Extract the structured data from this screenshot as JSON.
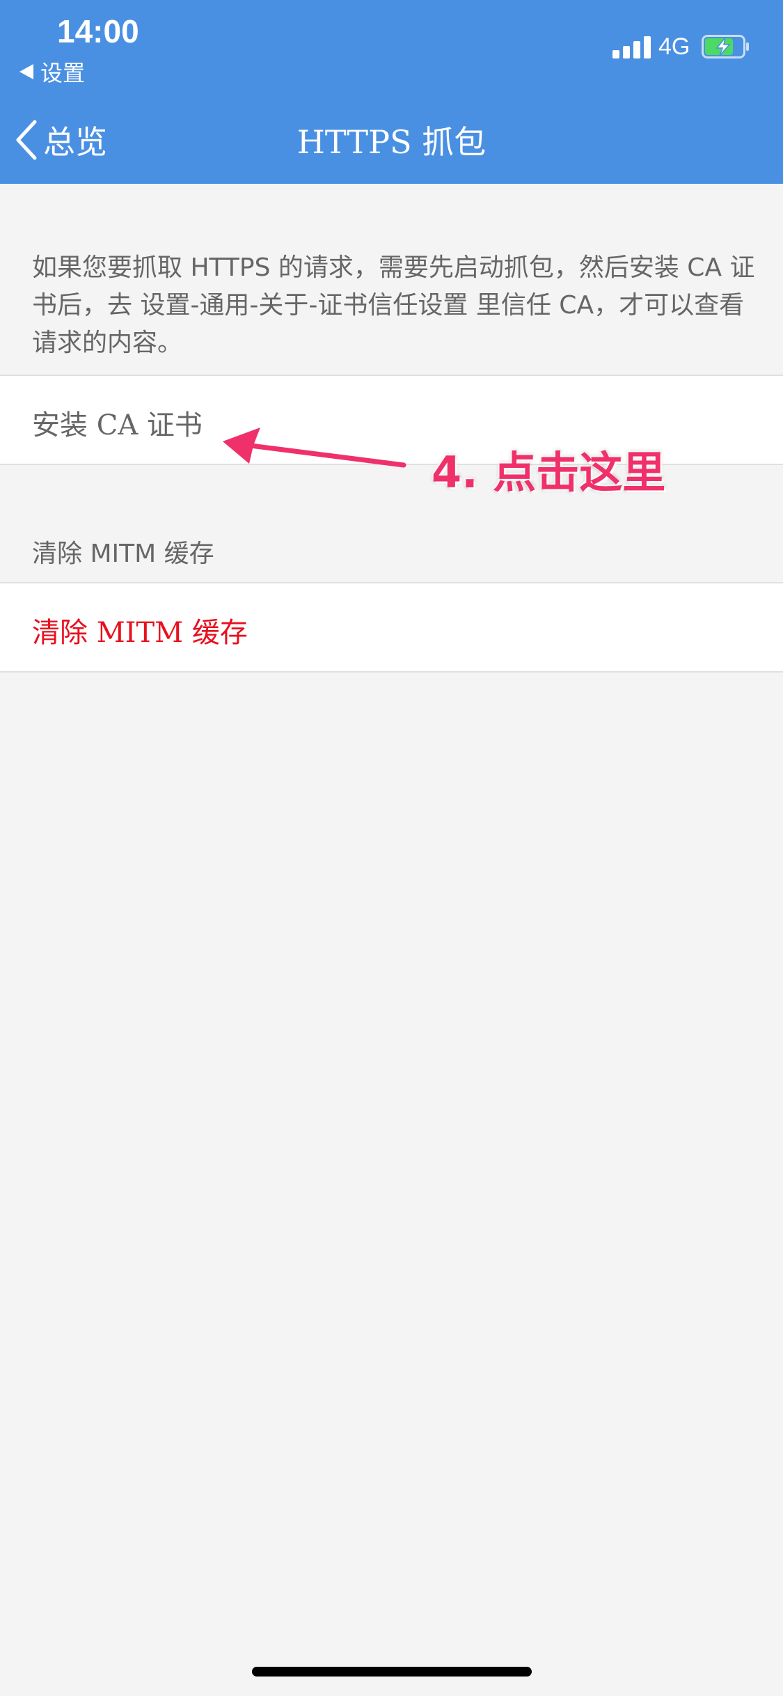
{
  "status_bar": {
    "time": "14:00",
    "back_app": "设置",
    "network": "4G",
    "signal_icon": "signal-bars-icon",
    "battery_icon": "battery-charging-icon",
    "colors": {
      "bar": "#4a90e2",
      "battery_fill": "#4cd964"
    }
  },
  "nav": {
    "back_label": "总览",
    "title": "HTTPS 抓包"
  },
  "info_text": "如果您要抓取 HTTPS 的请求，需要先启动抓包，然后安装 CA 证书后，去 设置-通用-关于-证书信任设置 里信任 CA，才可以查看请求的内容。",
  "install_row": {
    "label": "安装 CA 证书",
    "color": "#666666"
  },
  "annotation": {
    "text": "4. 点击这里",
    "color": "#f0306a"
  },
  "clear_section": {
    "header": "清除 MITM 缓存",
    "button_label": "清除 MITM 缓存",
    "button_color": "#e8101e"
  }
}
